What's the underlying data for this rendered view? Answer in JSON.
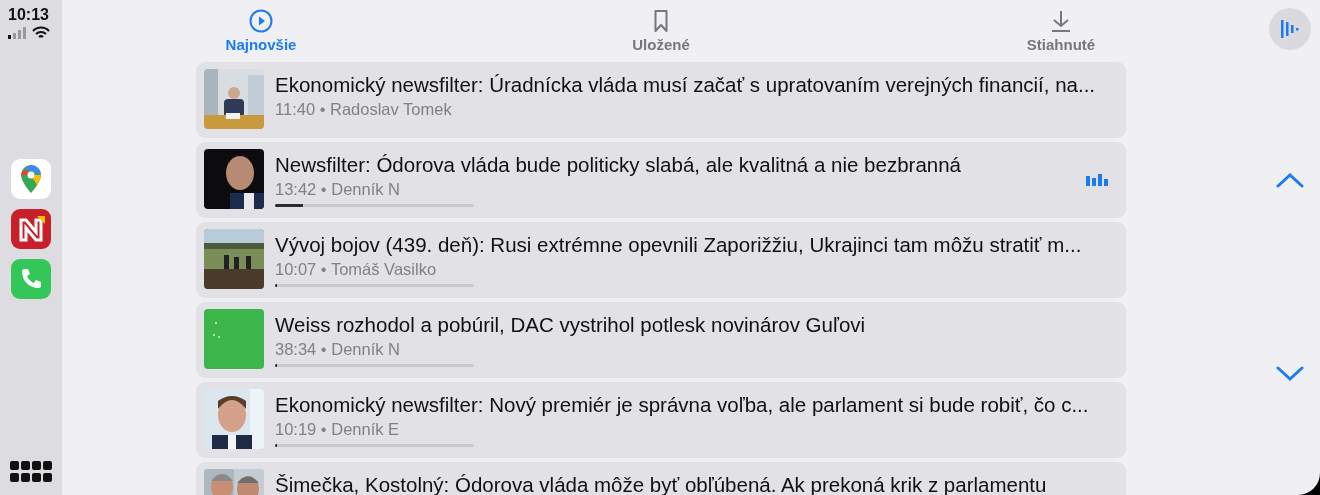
{
  "status_bar": {
    "time": "10:13"
  },
  "dock": [
    {
      "kind": "maps"
    },
    {
      "kind": "news"
    },
    {
      "kind": "phone"
    },
    {
      "kind": "grid"
    }
  ],
  "tabs": [
    {
      "label": "Najnovšie",
      "kind": "play",
      "selected": true
    },
    {
      "label": "Uložené",
      "kind": "bookmark",
      "selected": false
    },
    {
      "label": "Stiahnuté",
      "kind": "download",
      "selected": false
    }
  ],
  "episodes": [
    {
      "title": "Ekonomický newsfilter: Úradnícka vláda musí začať s upratovaním verejných financií, na...",
      "meta": "11:40 • Radoslav Tomek",
      "playing": false
    },
    {
      "title": "Newsfilter: Ódorova vláda bude politicky slabá, ale kvalitná a nie bezbranná",
      "meta": "13:42 • Denník N",
      "playing": true,
      "level": 0.14
    },
    {
      "title": "Vývoj bojov (439. deň): Rusi extrémne opevnili Zaporižžiu, Ukrajinci tam môžu stratiť m...",
      "meta": "10:07 • Tomáš Vasilko",
      "playing": false,
      "level": 0.01
    },
    {
      "title": "Weiss rozhodol a pobúril, DAC vystrihol potlesk novinárov Guľovi",
      "meta": "38:34 • Denník N",
      "playing": false,
      "level": 0.01
    },
    {
      "title": "Ekonomický newsfilter: Nový premiér je správna voľba, ale parlament si bude robiť, čo c...",
      "meta": "10:19 • Denník E",
      "playing": false,
      "level": 0
    },
    {
      "title": "Šimečka, Kostolný: Ódorova vláda môže byť obľúbená. Ak prekoná krik z parlamentu",
      "playing": false
    }
  ]
}
